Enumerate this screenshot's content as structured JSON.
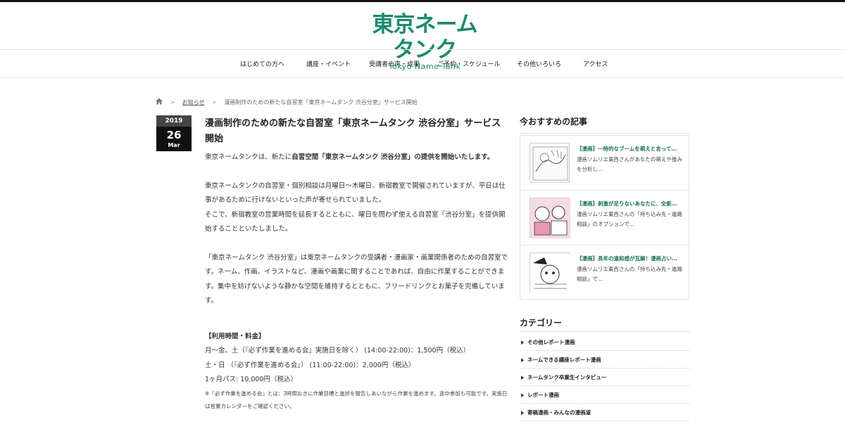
{
  "logo": {
    "main": "東京ネームタンク",
    "sub": "Tokyo Name Tank"
  },
  "nav": [
    "はじめての方へ",
    "講座・イベント",
    "受講者の声・成果",
    "ご予約・スケジュール",
    "その他いろいろ",
    "アクセス"
  ],
  "breadcrumb": {
    "home_icon": "home-icon",
    "category": "お知らせ",
    "current": "漫画制作のための新たな自習室「東京ネームタンク 渋谷分室」サービス開始"
  },
  "date": {
    "year": "2019",
    "day": "26",
    "month": "Mar"
  },
  "article": {
    "title": "漫画制作のための新たな自習室「東京ネームタンク 渋谷分室」サービス開始",
    "intro_pre": "東京ネームタンクは、新たに",
    "intro_bold": "自習空間「東京ネームタンク 渋谷分室」の提供を開始いたします。",
    "p2_1": "東京ネームタンクの自習室・個別相談は月曜日～木曜日、新宿教室で開催されていますが、平日は仕事があるために行けないといった声が寄せられていました。",
    "p2_2": "そこで、新宿教室の営業時間を延長するとともに、曜日を問わず使える自習室「渋谷分室」を提供開始することといたしました。",
    "p3": "「東京ネームタンク 渋谷分室」は東京ネームタンクの受講者・漫画家・画業関係者のための自習室です。ネーム、作画、イラストなど、漫画や画業に関することであれば、自由に作業することができます。集中を妨げないような静かな空間を維持するとともに、フリードリンクとお菓子を完備しています。",
    "fee_head": "【利用時間・料金】",
    "fee_1": "月～金、土（『必ず作業を進める会』実施日を除く） (14:00-22:00)：1,500円（税込）",
    "fee_2": "土・日 （『必ず作業を進める会』） (11:00-22:00)：2,000円（税込）",
    "fee_3": "1ヶ月パス: 10,000円（税込）",
    "note": "※『必ず作業を進める会』とは：3時間おきに作業目標と進捗を報告しあいながら作業を進めます。途中参加も可能です。実施日は営業カレンダーをご確認ください。"
  },
  "sidebar": {
    "recommend_head": "今おすすめの記事",
    "recommended": [
      {
        "title": "【漫画】一時的なブームを萌えと言って…",
        "desc": "漫画ソムリエ東西さんがあなたの萌えや推みを分析し…"
      },
      {
        "title": "【漫画】刺激が足りないあなたに、全新…",
        "desc": "漫画ソムリエ東西さんの「持ち込み先・進路相談」のオプションで…"
      },
      {
        "title": "【漫画】長年の違和感が瓦解！漫画占い…",
        "desc": "漫画ソムリエ東西さんの「持ち込み先・進路相談」で…"
      }
    ],
    "category_head": "カテゴリー",
    "categories": [
      "その他レポート漫画",
      "ネームできる講座レポート漫画",
      "ネームタンク卒業生インタビュー",
      "レポート漫画",
      "寄稿漫画・みんなの漫画道"
    ]
  }
}
